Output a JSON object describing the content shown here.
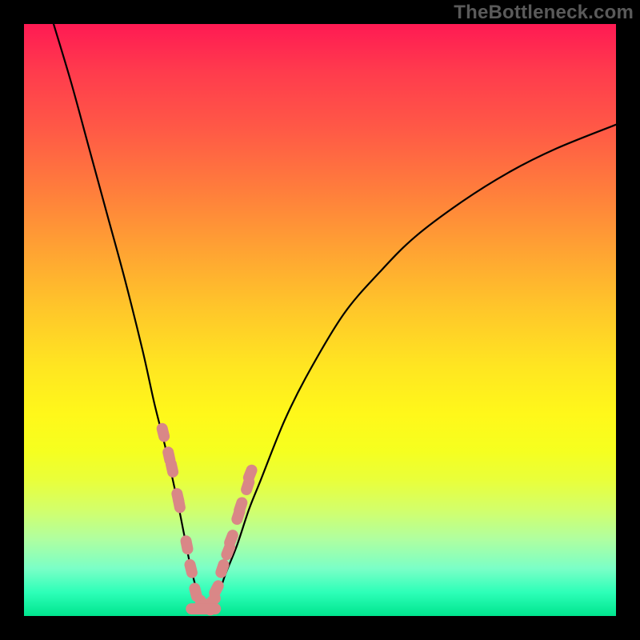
{
  "watermark": "TheBottleneck.com",
  "colors": {
    "frame": "#000000",
    "marker": "#d98787",
    "curve": "#000000",
    "gradient_top": "#ff1a53",
    "gradient_bottom": "#00e58e"
  },
  "chart_data": {
    "type": "line",
    "title": "",
    "xlabel": "",
    "ylabel": "",
    "xlim": [
      0,
      100
    ],
    "ylim": [
      0,
      100
    ],
    "note": "Axes are implicit (no tick labels shown). x is normalized horizontal position 0-100, y is bottleneck % 0-100 (0 at bottom). Curve is a V shape with vertex near x≈30.",
    "series": [
      {
        "name": "bottleneck-curve",
        "x": [
          5,
          8,
          11,
          14,
          17,
          20,
          22,
          24,
          26,
          27,
          28,
          29,
          30,
          31,
          32,
          33,
          34,
          36,
          38,
          40,
          44,
          48,
          54,
          60,
          66,
          74,
          82,
          90,
          100
        ],
        "y": [
          100,
          90,
          79,
          68,
          57,
          45,
          36,
          28,
          19,
          14,
          9,
          5,
          2,
          1,
          2,
          4,
          7,
          12,
          18,
          23,
          33,
          41,
          51,
          58,
          64,
          70,
          75,
          79,
          83
        ]
      }
    ],
    "markers": {
      "name": "highlighted-points",
      "x": [
        23.5,
        24.5,
        25.0,
        26.0,
        26.2,
        27.5,
        28.2,
        29.0,
        30.0,
        31.0,
        31.8,
        32.5,
        33.5,
        34.5,
        35.0,
        36.2,
        36.6,
        37.8,
        38.2
      ],
      "y": [
        31,
        27,
        25,
        20,
        19,
        12,
        8,
        4,
        2,
        1.5,
        2.5,
        4.5,
        8,
        11,
        13,
        17,
        18.5,
        22,
        24
      ]
    }
  }
}
